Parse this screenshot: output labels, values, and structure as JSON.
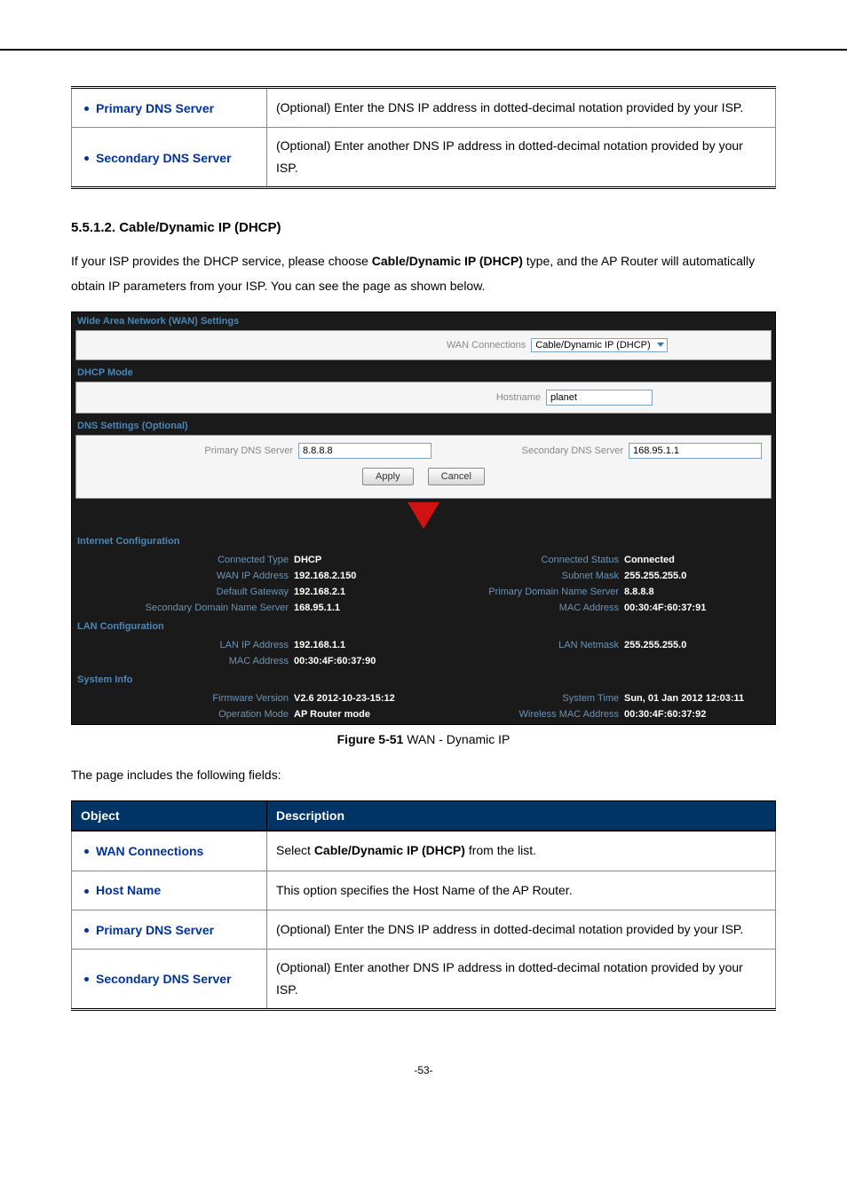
{
  "top_table": {
    "rows": [
      {
        "label": "Primary DNS Server",
        "desc": "(Optional) Enter the DNS IP address in dotted-decimal notation provided by your ISP."
      },
      {
        "label": "Secondary DNS Server",
        "desc": "(Optional) Enter another DNS IP address in dotted-decimal notation provided by your ISP."
      }
    ]
  },
  "section": {
    "number": "5.5.1.2.",
    "title": "Cable/Dynamic IP (DHCP)",
    "body_pre": "If your ISP provides the DHCP service, please choose ",
    "body_bold": "Cable/Dynamic IP (DHCP)",
    "body_post": " type, and the AP Router will automatically obtain IP parameters from your ISP. You can see the page as shown below."
  },
  "screenshot": {
    "title": "Wide Area Network (WAN) Settings",
    "wan_conn_label": "WAN Connections",
    "wan_conn_value": "Cable/Dynamic IP (DHCP)",
    "dhcp_mode": "DHCP Mode",
    "hostname_label": "Hostname",
    "hostname_value": "planet",
    "dns_header": "DNS Settings (Optional)",
    "primary_dns_label": "Primary DNS Server",
    "primary_dns_value": "8.8.8.8",
    "secondary_dns_label": "Secondary DNS Server",
    "secondary_dns_value": "168.95.1.1",
    "apply": "Apply",
    "cancel": "Cancel",
    "internet_config": "Internet Configuration",
    "grid1": [
      {
        "l1": "Connected Type",
        "v1": "DHCP",
        "l2": "Connected Status",
        "v2": "Connected"
      },
      {
        "l1": "WAN IP Address",
        "v1": "192.168.2.150",
        "l2": "Subnet Mask",
        "v2": "255.255.255.0"
      },
      {
        "l1": "Default Gateway",
        "v1": "192.168.2.1",
        "l2": "Primary Domain Name Server",
        "v2": "8.8.8.8"
      },
      {
        "l1": "Secondary Domain Name Server",
        "v1": "168.95.1.1",
        "l2": "MAC Address",
        "v2": "00:30:4F:60:37:91"
      }
    ],
    "lan_config": "LAN Configuration",
    "grid2": [
      {
        "l1": "LAN IP Address",
        "v1": "192.168.1.1",
        "l2": "LAN Netmask",
        "v2": "255.255.255.0"
      },
      {
        "l1": "MAC Address",
        "v1": "00:30:4F:60:37:90",
        "l2": "",
        "v2": ""
      }
    ],
    "system_info": "System Info",
    "grid3": [
      {
        "l1": "Firmware Version",
        "v1": "V2.6 2012-10-23-15:12",
        "l2": "System Time",
        "v2": "Sun, 01 Jan 2012 12:03:11"
      },
      {
        "l1": "Operation Mode",
        "v1": "AP Router mode",
        "l2": "Wireless MAC Address",
        "v2": "00:30:4F:60:37:92"
      }
    ]
  },
  "figure": {
    "label": "Figure 5-51",
    "caption": " WAN - Dynamic IP"
  },
  "fields_intro": "The page includes the following fields:",
  "fields_table": {
    "headers": {
      "object": "Object",
      "description": "Description"
    },
    "rows": [
      {
        "label": "WAN Connections",
        "desc_pre": "Select ",
        "desc_bold": "Cable/Dynamic IP (DHCP)",
        "desc_post": " from the list."
      },
      {
        "label": "Host Name",
        "desc_pre": "This option specifies the Host Name of the AP Router.",
        "desc_bold": "",
        "desc_post": ""
      },
      {
        "label": "Primary DNS Server",
        "desc_pre": "(Optional) Enter the DNS IP address in dotted-decimal notation provided by your ISP.",
        "desc_bold": "",
        "desc_post": ""
      },
      {
        "label": "Secondary DNS Server",
        "desc_pre": "(Optional) Enter another DNS IP address in dotted-decimal notation provided by your ISP.",
        "desc_bold": "",
        "desc_post": ""
      }
    ]
  },
  "pagenum": "-53-"
}
